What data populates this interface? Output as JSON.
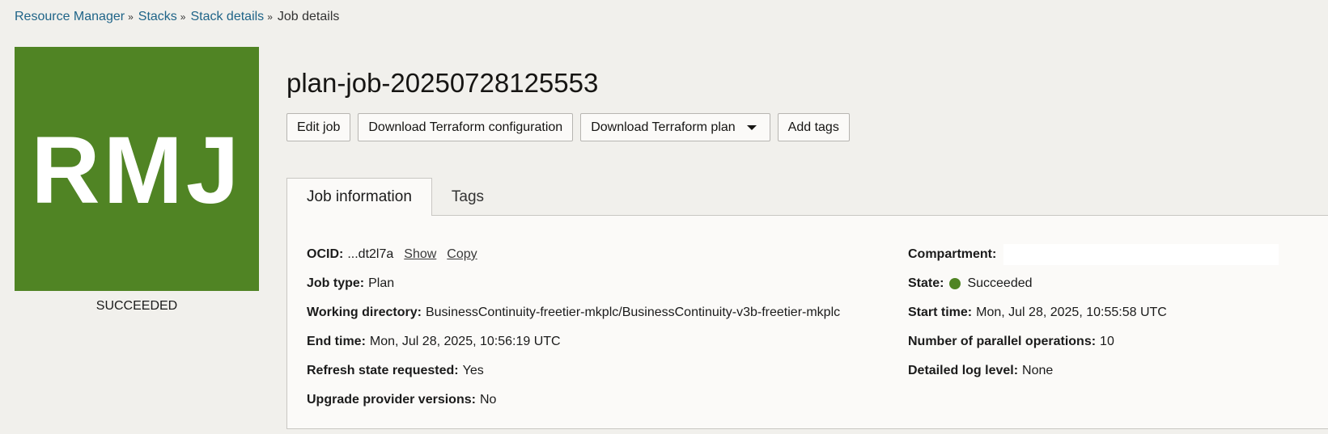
{
  "breadcrumb": {
    "items": [
      "Resource Manager",
      "Stacks",
      "Stack details"
    ],
    "separator": "»",
    "current": "Job details"
  },
  "logo": {
    "text": "RMJ",
    "color": "#508424"
  },
  "status_label": "SUCCEEDED",
  "title": "plan-job-20250728125553",
  "actions": {
    "edit": "Edit job",
    "download_config": "Download Terraform configuration",
    "download_plan": "Download Terraform plan",
    "add_tags": "Add tags"
  },
  "tabs": {
    "job_information": "Job information",
    "tags": "Tags"
  },
  "info": {
    "ocid": {
      "label": "OCID:",
      "value": "...dt2l7a",
      "show": "Show",
      "copy": "Copy"
    },
    "job_type": {
      "label": "Job type:",
      "value": "Plan"
    },
    "working_dir": {
      "label": "Working directory:",
      "value": "BusinessContinuity-freetier-mkplc/BusinessContinuity-v3b-freetier-mkplc"
    },
    "end_time": {
      "label": "End time:",
      "value": "Mon, Jul 28, 2025, 10:56:19 UTC"
    },
    "refresh_state": {
      "label": "Refresh state requested:",
      "value": "Yes"
    },
    "upgrade_provider": {
      "label": "Upgrade provider versions:",
      "value": "No"
    },
    "compartment": {
      "label": "Compartment:",
      "value": ""
    },
    "state": {
      "label": "State:",
      "value": "Succeeded",
      "color": "#508424"
    },
    "start_time": {
      "label": "Start time:",
      "value": "Mon, Jul 28, 2025, 10:55:58 UTC"
    },
    "parallel_ops": {
      "label": "Number of parallel operations:",
      "value": "10"
    },
    "log_level": {
      "label": "Detailed log level:",
      "value": "None"
    }
  }
}
